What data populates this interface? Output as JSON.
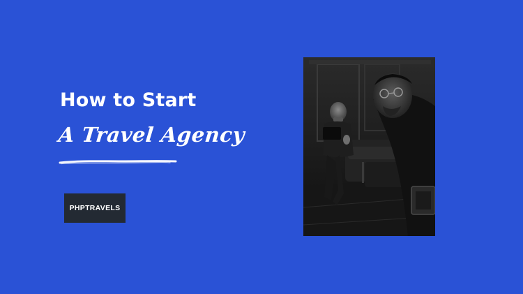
{
  "colors": {
    "background": "#2a52d6",
    "text": "#ffffff",
    "badge_background": "#232a33",
    "photo_dark": "#121212"
  },
  "headline": {
    "line1": "How to Start",
    "line2": "A Travel Agency"
  },
  "brand": {
    "label": "PHPTRAVELS"
  },
  "photo": {
    "description_icon": "monochrome-portrait-photo"
  }
}
